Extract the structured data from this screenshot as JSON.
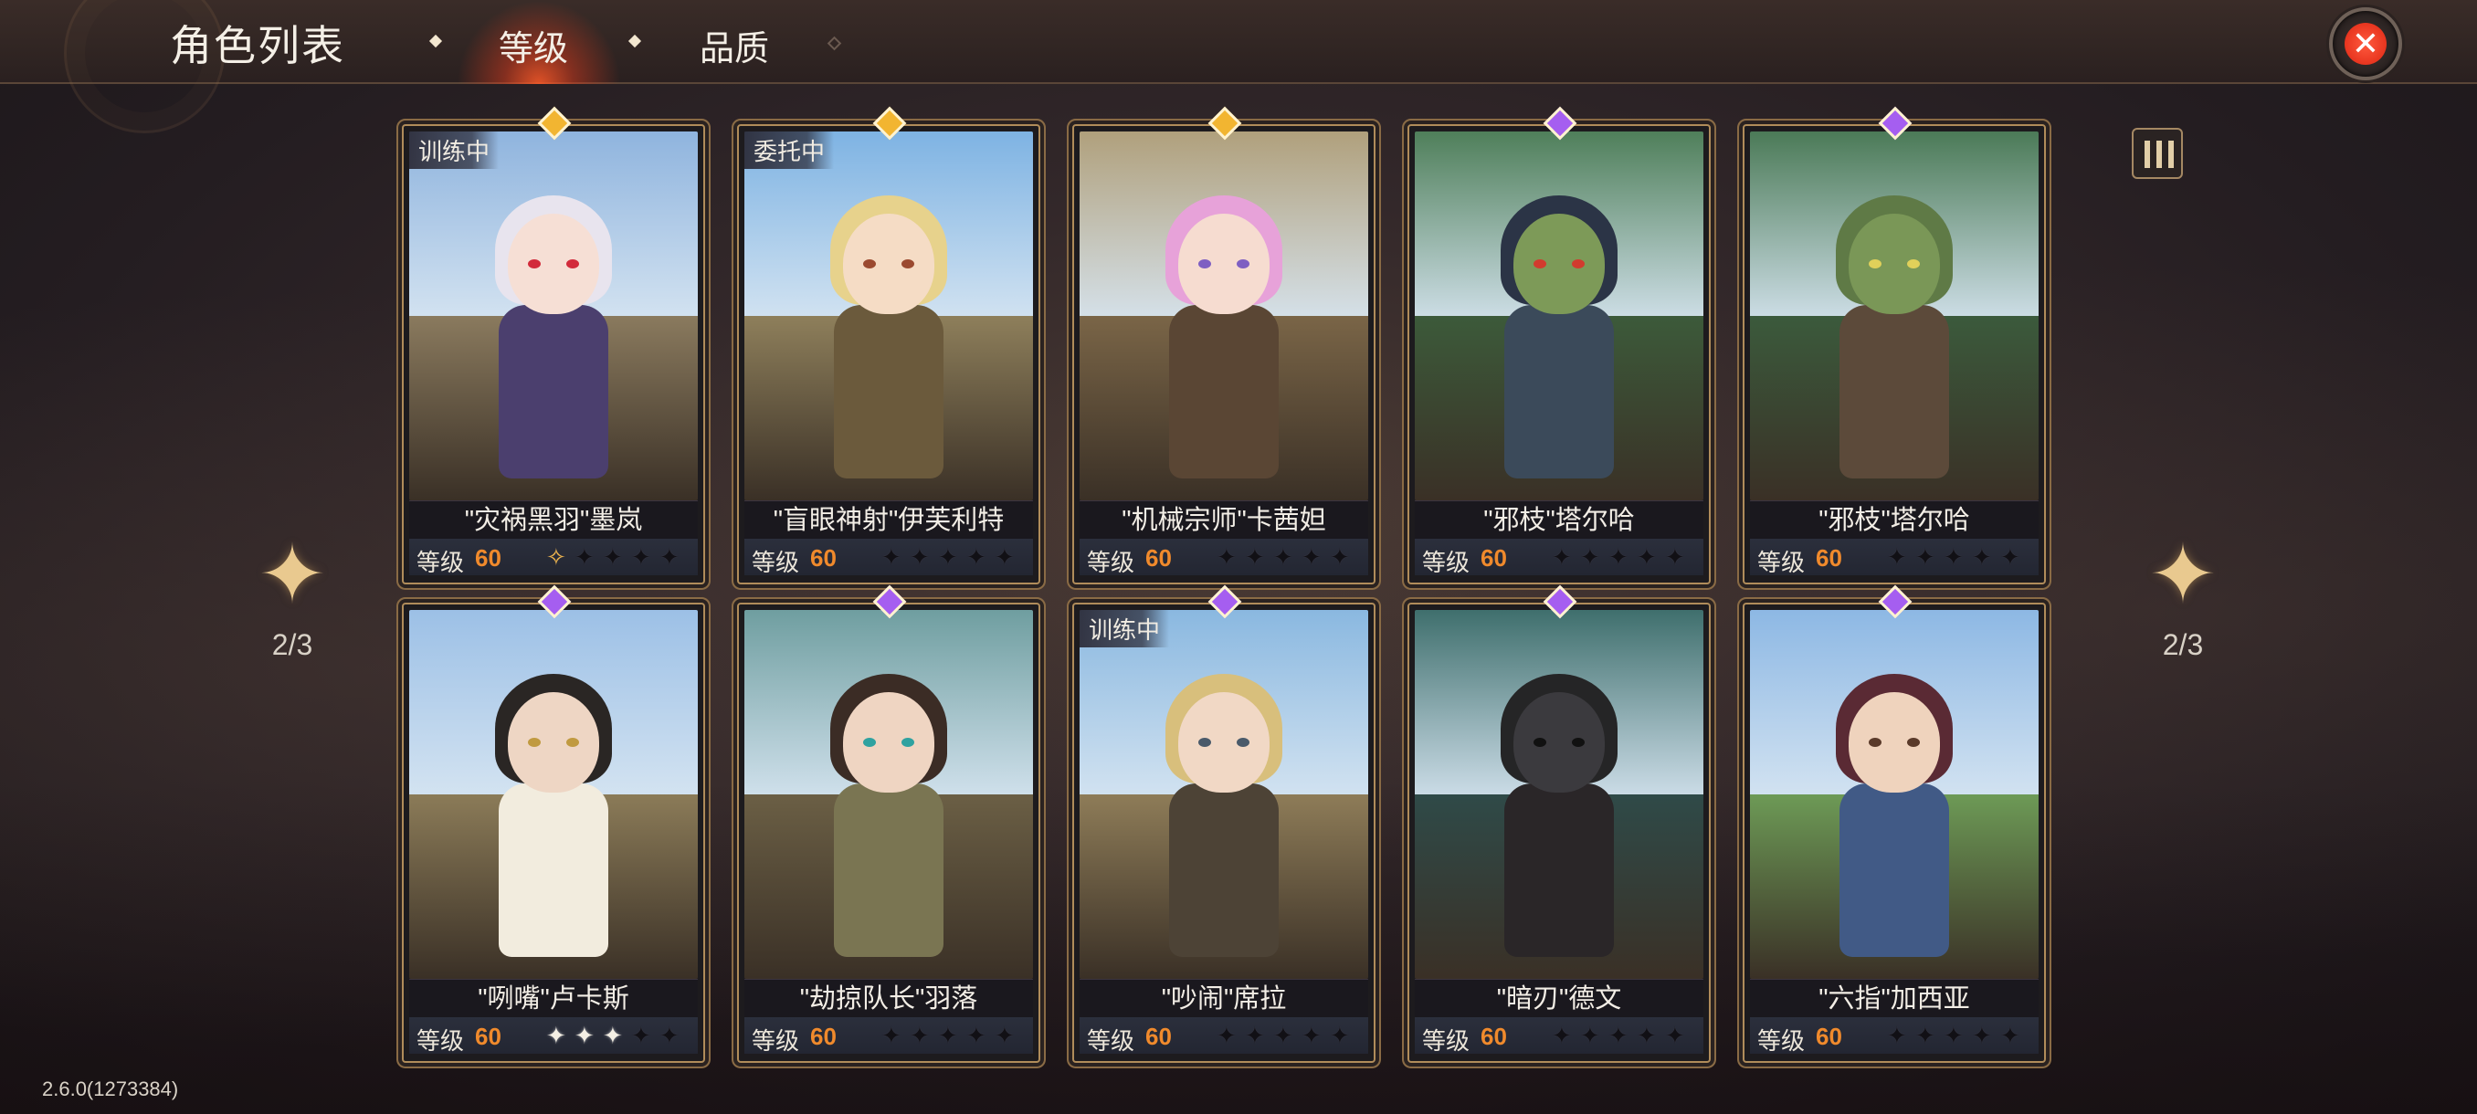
{
  "header": {
    "title": "角色列表",
    "tabs": [
      {
        "label": "等级",
        "active": true
      },
      {
        "label": "品质",
        "active": false
      }
    ],
    "close_icon": "close-x-icon"
  },
  "pagination": {
    "left": "2/3",
    "right": "2/3"
  },
  "version": "2.6.0(1273384)",
  "level_label": "等级",
  "colors": {
    "accent_orange": "#f08a2c",
    "gem_gold": "#f2b531",
    "gem_purple": "#a55ef0",
    "active_tab_glow": "#e8401f"
  },
  "characters": [
    {
      "name": "\"灾祸黑羽\"墨岚",
      "level": "60",
      "status": "训练中",
      "gem": "gold",
      "stars_filled": 0,
      "star_outline": 1
    },
    {
      "name": "\"盲眼神射\"伊芙利特",
      "level": "60",
      "status": "委托中",
      "gem": "gold",
      "stars_filled": 0,
      "star_outline": 0
    },
    {
      "name": "\"机械宗师\"卡茜妲",
      "level": "60",
      "status": "",
      "gem": "gold",
      "stars_filled": 0,
      "star_outline": 0
    },
    {
      "name": "\"邪枝\"塔尔哈",
      "level": "60",
      "status": "",
      "gem": "purple",
      "stars_filled": 0,
      "star_outline": 0
    },
    {
      "name": "\"邪枝\"塔尔哈",
      "level": "60",
      "status": "",
      "gem": "purple",
      "stars_filled": 0,
      "star_outline": 0
    },
    {
      "name": "\"咧嘴\"卢卡斯",
      "level": "60",
      "status": "",
      "gem": "purple",
      "stars_filled": 3,
      "star_outline": 0
    },
    {
      "name": "\"劫掠队长\"羽落",
      "level": "60",
      "status": "",
      "gem": "purple",
      "stars_filled": 0,
      "star_outline": 0
    },
    {
      "name": "\"吵闹\"席拉",
      "level": "60",
      "status": "训练中",
      "gem": "purple",
      "stars_filled": 0,
      "star_outline": 0
    },
    {
      "name": "\"暗刃\"德文",
      "level": "60",
      "status": "",
      "gem": "purple",
      "stars_filled": 0,
      "star_outline": 0
    },
    {
      "name": "\"六指\"加西亚",
      "level": "60",
      "status": "",
      "gem": "purple",
      "stars_filled": 0,
      "star_outline": 0
    }
  ]
}
